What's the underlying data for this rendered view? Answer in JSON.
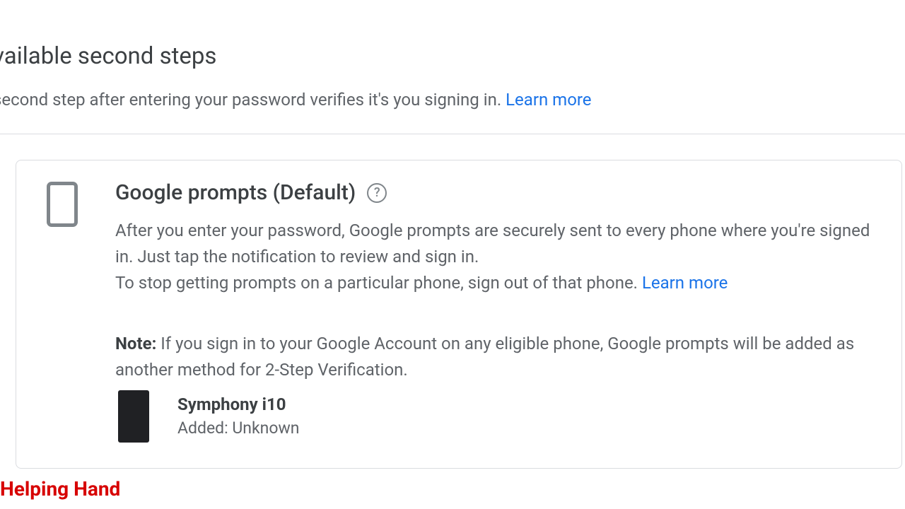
{
  "header": {
    "title": "vailable second steps",
    "subtext": "second step after entering your password verifies it's you signing in. ",
    "learn_more": "Learn more"
  },
  "card": {
    "title": "Google prompts (Default)",
    "help_symbol": "?",
    "desc_line1": "After you enter your password, Google prompts are securely sent to every phone where you're signed in. Just tap the notification to review and sign in.",
    "desc_line2_prefix": "To stop getting prompts on a particular phone, sign out of that phone. ",
    "learn_more": "Learn more",
    "note_label": "Note:",
    "note_text": " If you sign in to your Google Account on any eligible phone, Google prompts will be added as another method for 2-Step Verification.",
    "device": {
      "name": "Symphony i10",
      "added": "Added: Unknown"
    }
  },
  "watermark": "Helping Hand"
}
